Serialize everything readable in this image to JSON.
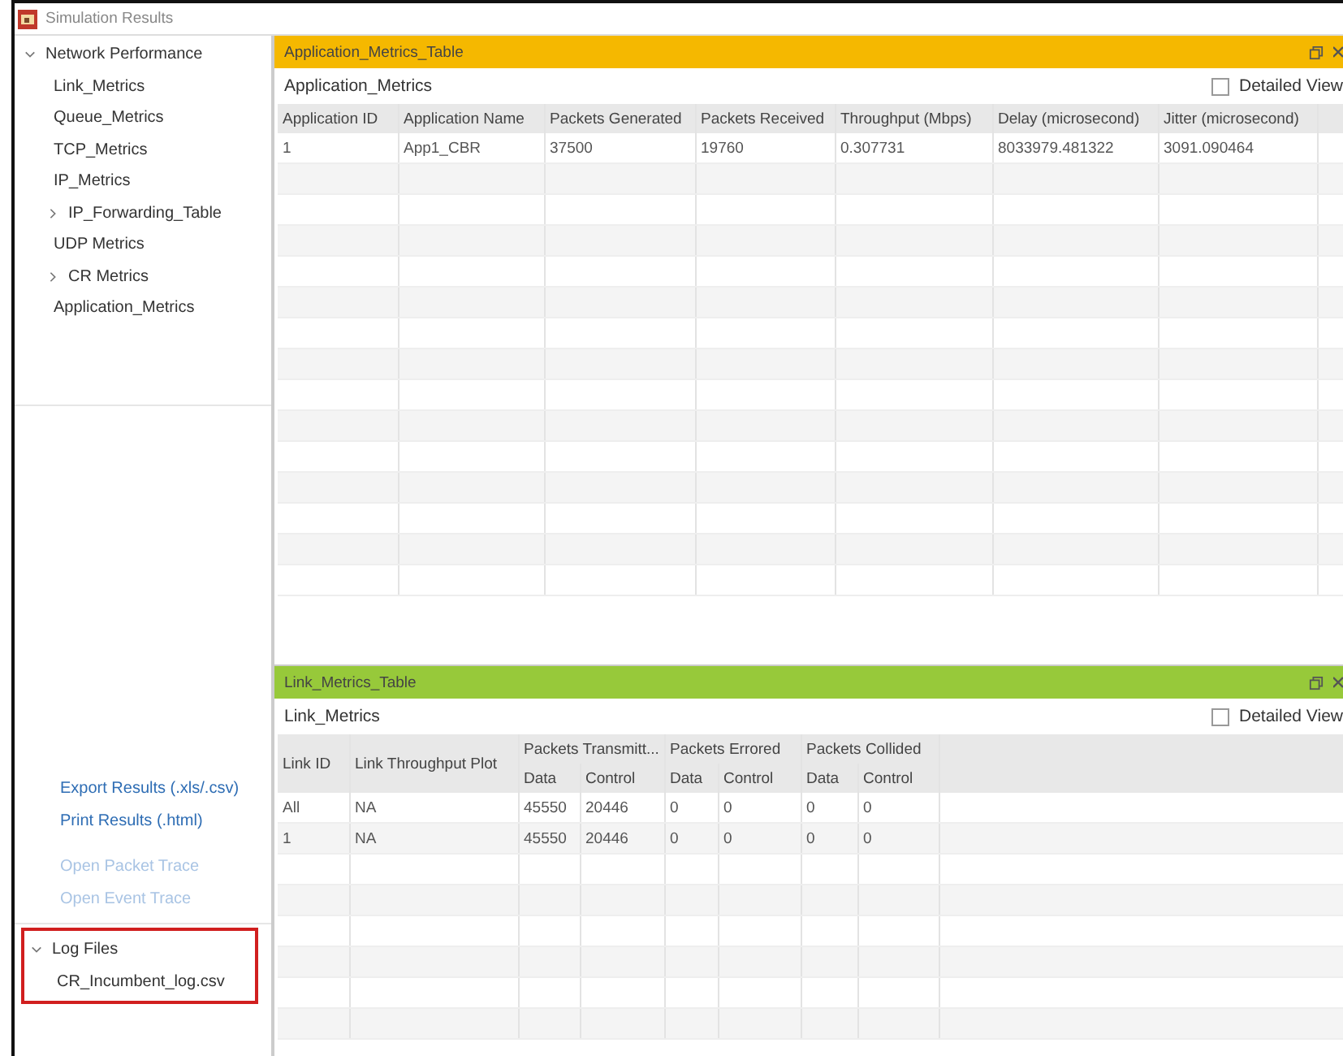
{
  "window": {
    "title": "Simulation Results"
  },
  "sidebar": {
    "tree": [
      {
        "label": "Network Performance",
        "expanded": true,
        "children": [
          {
            "label": "Link_Metrics"
          },
          {
            "label": "Queue_Metrics"
          },
          {
            "label": "TCP_Metrics"
          },
          {
            "label": "IP_Metrics"
          },
          {
            "label": "IP_Forwarding_Table",
            "expanded": false
          },
          {
            "label": "UDP Metrics"
          },
          {
            "label": "CR Metrics",
            "expanded": false
          },
          {
            "label": "Application_Metrics"
          }
        ]
      }
    ],
    "links": [
      {
        "label": "Export Results (.xls/.csv)",
        "disabled": false
      },
      {
        "label": "Print Results (.html)",
        "disabled": false
      },
      {
        "label": "Open Packet Trace",
        "disabled": true
      },
      {
        "label": "Open Event Trace",
        "disabled": true
      }
    ],
    "log_files": {
      "label": "Log Files",
      "expanded": true,
      "highlighted": true,
      "children": [
        {
          "label": "CR_Incumbent_log.csv"
        }
      ]
    }
  },
  "panels": [
    {
      "title": "Application_Metrics_Table",
      "color": "#f5b800",
      "heading": "Application_Metrics",
      "detailed_view": {
        "label": "Detailed View",
        "checked": false
      },
      "columns": [
        "Application ID",
        "Application Name",
        "Packets Generated",
        "Packets Received",
        "Throughput (Mbps)",
        "Delay (microsecond)",
        "Jitter (microsecond)"
      ],
      "rows": [
        [
          "1",
          "App1_CBR",
          "37500",
          "19760",
          "0.307731",
          "8033979.481322",
          "3091.090464"
        ]
      ]
    },
    {
      "title": "Link_Metrics_Table",
      "color": "#97c93a",
      "heading": "Link_Metrics",
      "detailed_view": {
        "label": "Detailed View",
        "checked": false
      },
      "column_groups": [
        {
          "label": "Link ID"
        },
        {
          "label": "Link Throughput Plot"
        },
        {
          "label": "Packets Transmitt...",
          "sub": [
            "Data",
            "Control"
          ]
        },
        {
          "label": "Packets Errored",
          "sub": [
            "Data",
            "Control"
          ]
        },
        {
          "label": "Packets Collided",
          "sub": [
            "Data",
            "Control"
          ]
        }
      ],
      "rows": [
        [
          "All",
          "NA",
          "45550",
          "20446",
          "0",
          "0",
          "0",
          "0"
        ],
        [
          "1",
          "NA",
          "45550",
          "20446",
          "0",
          "0",
          "0",
          "0"
        ]
      ]
    }
  ]
}
